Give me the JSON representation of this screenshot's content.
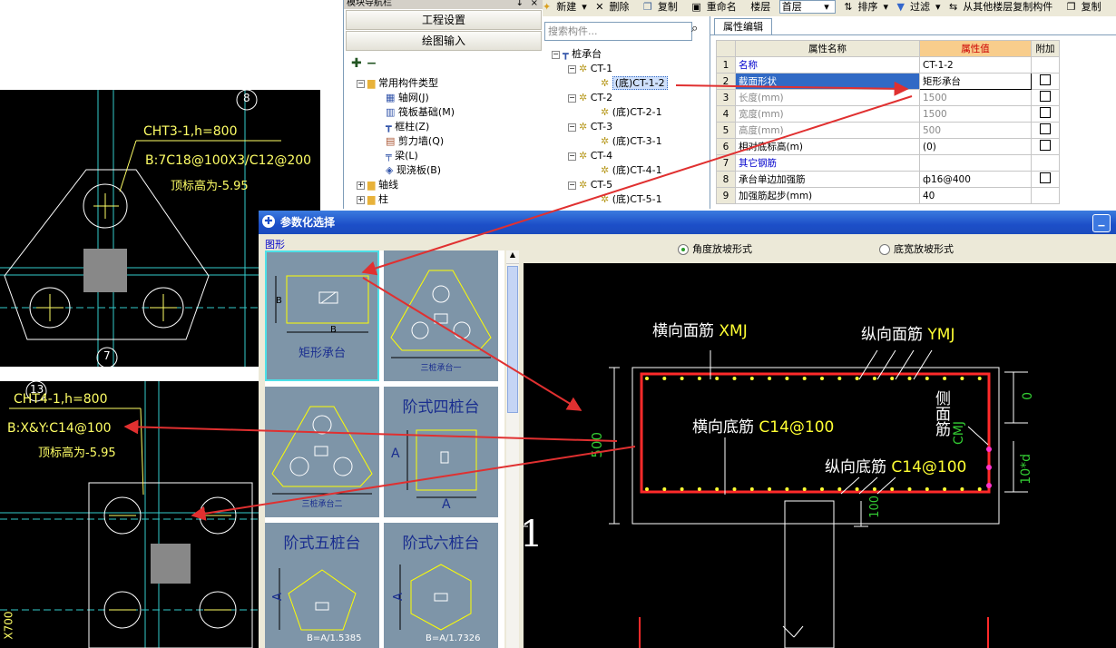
{
  "left_cad": {
    "top_label_axis": "8",
    "top_title": "CHT3-1,h=800",
    "top_rebar": "B:7C18@100X3/C12@200",
    "top_elev": "顶标高为-5.95",
    "top_bottom_axis": "7",
    "bottom_label_axis": "13",
    "bottom_title": "CHT4-1,h=800",
    "bottom_rebar": "B:X&Y:C14@100",
    "bottom_elev": "顶标高为-5.95",
    "side_text": "X700",
    "colors": {
      "cad_bg": "#000000",
      "text_yellow": "#ffff66",
      "line_cyan": "#33cccc",
      "line_white": "#ffffff",
      "column_gray": "#888888",
      "arrow_red": "#e03030"
    }
  },
  "nav": {
    "header": "模块导航栏",
    "pin": "↓",
    "close": "×",
    "btn_project": "工程设置",
    "btn_draw": "绘图输入",
    "tree": [
      {
        "label": "常用构件类型",
        "icon": "folder-icon"
      },
      {
        "label": "轴网(J)",
        "icon": "grid-icon"
      },
      {
        "label": "筏板基础(M)",
        "icon": "raft-icon"
      },
      {
        "label": "框柱(Z)",
        "icon": "column-icon"
      },
      {
        "label": "剪力墙(Q)",
        "icon": "wall-icon"
      },
      {
        "label": "梁(L)",
        "icon": "beam-icon"
      },
      {
        "label": "现浇板(B)",
        "icon": "slab-icon"
      },
      {
        "label": "轴线",
        "icon": "folder-icon"
      },
      {
        "label": "柱",
        "icon": "folder-icon"
      }
    ]
  },
  "toolbar": {
    "new": "新建",
    "delete": "删除",
    "copy": "复制",
    "rename": "重命名",
    "floor_label": "楼层",
    "floor_value": "首层",
    "sort": "排序",
    "filter": "过滤",
    "copy_from": "从其他楼层复制构件",
    "copy_short": "复制"
  },
  "components": {
    "search_placeholder": "搜索构件...",
    "root": "桩承台",
    "items": [
      {
        "name": "CT-1",
        "child": "(底)CT-1-2"
      },
      {
        "name": "CT-2",
        "child": "(底)CT-2-1"
      },
      {
        "name": "CT-3",
        "child": "(底)CT-3-1"
      },
      {
        "name": "CT-4",
        "child": "(底)CT-4-1"
      },
      {
        "name": "CT-5",
        "child": "(底)CT-5-1"
      }
    ]
  },
  "props": {
    "tab": "属性编辑",
    "headers": [
      "属性名称",
      "属性值",
      "附加"
    ],
    "rows": [
      {
        "no": "1",
        "name": "名称",
        "value": "CT-1-2",
        "style": "blue",
        "check": false
      },
      {
        "no": "2",
        "name": "截面形状",
        "value": "矩形承台",
        "style": "sel",
        "check": true
      },
      {
        "no": "3",
        "name": "长度(mm)",
        "value": "1500",
        "style": "gray",
        "check": true
      },
      {
        "no": "4",
        "name": "宽度(mm)",
        "value": "1500",
        "style": "gray",
        "check": true
      },
      {
        "no": "5",
        "name": "高度(mm)",
        "value": "500",
        "style": "gray",
        "check": true
      },
      {
        "no": "6",
        "name": "相对底标高(m)",
        "value": "(0)",
        "style": "",
        "check": true
      },
      {
        "no": "7",
        "name": "其它钢筋",
        "value": "",
        "style": "blue",
        "check": false
      },
      {
        "no": "8",
        "name": "承台单边加强筋",
        "value": "ф16@400",
        "style": "",
        "check": true
      },
      {
        "no": "9",
        "name": "加强筋起步(mm)",
        "value": "40",
        "style": "",
        "check": false
      }
    ]
  },
  "dialog": {
    "title": "参数化选择",
    "group_label": "图形",
    "radio_angle": "角度放坡形式",
    "radio_width": "底宽放坡形式",
    "shapes": [
      {
        "label": "矩形承台",
        "dim_b": "B"
      },
      {
        "label": "三桩承台一",
        "dim_b": ""
      },
      {
        "label": "三桩承台二",
        "dim_b": ""
      },
      {
        "label": "阶式四桩台",
        "dim_a": "A"
      },
      {
        "label": "阶式五桩台",
        "dim_a": "A",
        "formula": "B=A/1.5385"
      },
      {
        "label": "阶式六桩台",
        "dim_a": "A",
        "formula": "B=A/1.7326"
      }
    ],
    "preview": {
      "top_x": "横向面筋",
      "top_x_code": "XMJ",
      "top_y": "纵向面筋",
      "top_y_code": "YMJ",
      "bot_x": "横向底筋",
      "bot_x_val": "C14@100",
      "bot_y": "纵向底筋",
      "bot_y_val": "C14@100",
      "side": "侧面筋",
      "side_code": "CMJ",
      "height": "500",
      "dim_zero": "0",
      "dim_10d": "10*d",
      "dim_100": "100",
      "left_mark": "1"
    }
  }
}
